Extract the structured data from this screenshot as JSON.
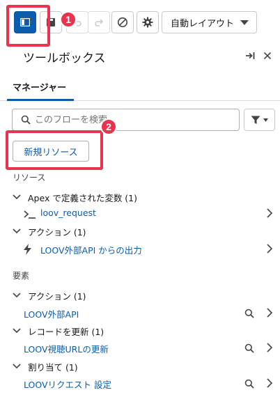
{
  "toolbar": {
    "layout_select": "自動レイアウト"
  },
  "annotations": {
    "badge1": "1",
    "badge2": "2"
  },
  "panel": {
    "title": "ツールボックス"
  },
  "tabs": {
    "manager": "マネージャー"
  },
  "search": {
    "placeholder": "このフローを検索..."
  },
  "new_resource_label": "新規リソース",
  "resources": {
    "section_label": "リソース",
    "groups": [
      {
        "label": "Apex で定義された変数 (1)",
        "items": [
          "loov_request"
        ]
      },
      {
        "label": "アクション (1)",
        "items": [
          "LOOV外部API からの出力"
        ]
      }
    ]
  },
  "elements": {
    "section_label": "要素",
    "groups": [
      {
        "label": "アクション (1)",
        "items": [
          "LOOV外部API"
        ]
      },
      {
        "label": "レコードを更新 (1)",
        "items": [
          "LOOV視聴URLの更新"
        ]
      },
      {
        "label": "割り当て (1)",
        "items": [
          "LOOVリクエスト 設定"
        ]
      }
    ]
  },
  "colors": {
    "brand": "#0b5cab",
    "highlight": "#e8344e"
  }
}
